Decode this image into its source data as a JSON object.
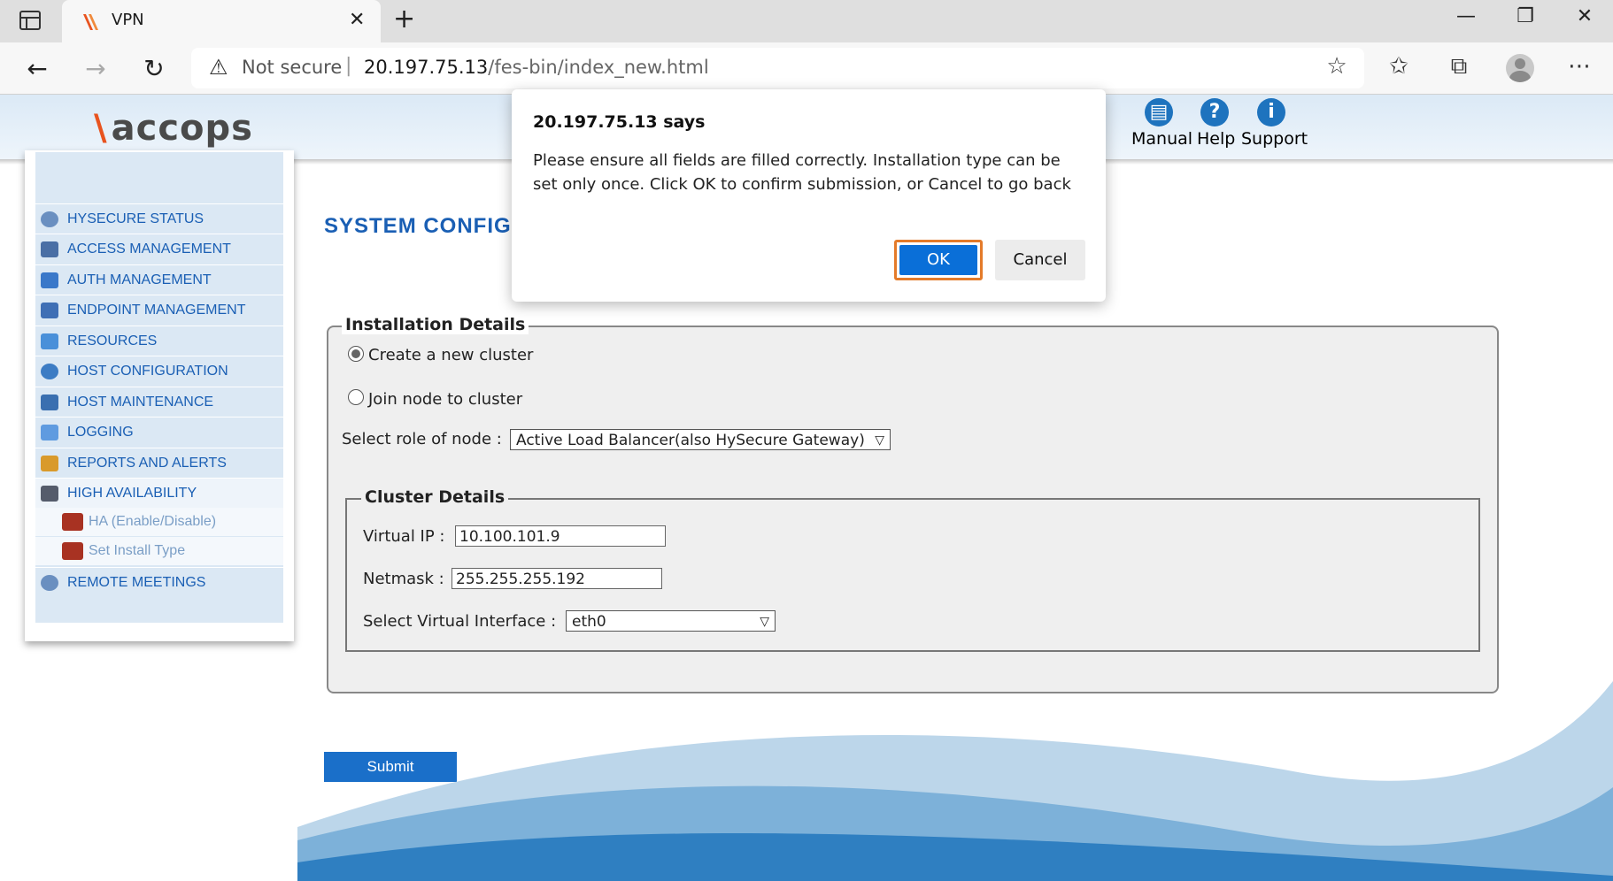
{
  "browser": {
    "tab_title": "VPN",
    "tab_close": "✕",
    "new_tab": "+",
    "window_controls": {
      "minimize": "—",
      "maximize": "❐",
      "close": "✕"
    },
    "url_security": "Not secure",
    "url_host": "20.197.75.13",
    "url_path": "/fes-bin/index_new.html",
    "icons": [
      "back-icon",
      "forward-icon",
      "refresh-icon",
      "warning-icon",
      "add-favorite-icon",
      "favorites-icon",
      "collections-icon",
      "profile-icon",
      "more-icon"
    ]
  },
  "header": {
    "logo_text": "accops",
    "links": [
      {
        "label": "Manual",
        "icon": "manual-icon"
      },
      {
        "label": "Help",
        "icon": "help-icon"
      },
      {
        "label": "Support",
        "icon": "info-icon"
      }
    ]
  },
  "sidebar": {
    "items": [
      {
        "label": "HYSECURE STATUS",
        "icon_color": "#6a8fc0"
      },
      {
        "label": "ACCESS MANAGEMENT",
        "icon_color": "#4a6fa5"
      },
      {
        "label": "AUTH MANAGEMENT",
        "icon_color": "#3a78c9"
      },
      {
        "label": "ENDPOINT MANAGEMENT",
        "icon_color": "#3f6fb5"
      },
      {
        "label": "RESOURCES",
        "icon_color": "#4a90d9"
      },
      {
        "label": "HOST CONFIGURATION",
        "icon_color": "#3c7cc4"
      },
      {
        "label": "HOST MAINTENANCE",
        "icon_color": "#3a6fb0"
      },
      {
        "label": "LOGGING",
        "icon_color": "#5f9be0"
      },
      {
        "label": "REPORTS AND ALERTS",
        "icon_color": "#d99a2b"
      },
      {
        "label": "HIGH AVAILABILITY",
        "icon_color": "#555c6b"
      }
    ],
    "subitems": [
      {
        "label": "HA (Enable/Disable)"
      },
      {
        "label": "Set Install Type"
      }
    ],
    "last_item": {
      "label": "REMOTE MEETINGS",
      "icon_color": "#6a8fc0"
    }
  },
  "main": {
    "title": "SYSTEM CONFIG",
    "installation": {
      "legend": "Installation Details",
      "option_create": "Create a new cluster",
      "option_join": "Join node to cluster",
      "selected_option": "create",
      "role_label": "Select role of node :",
      "role_value": "Active Load Balancer(also HySecure Gateway)"
    },
    "cluster": {
      "legend": "Cluster Details",
      "virtual_ip_label": "Virtual IP :",
      "virtual_ip_value": "10.100.101.9",
      "netmask_label": "Netmask :",
      "netmask_value": "255.255.255.192",
      "interface_label": "Select Virtual Interface :",
      "interface_value": "eth0"
    },
    "submit_label": "Submit"
  },
  "dialog": {
    "title": "20.197.75.13 says",
    "message": "Please ensure all fields are filled correctly. Installation type can be set only once. Click OK to confirm submission, or Cancel to go back",
    "ok_label": "OK",
    "cancel_label": "Cancel"
  }
}
